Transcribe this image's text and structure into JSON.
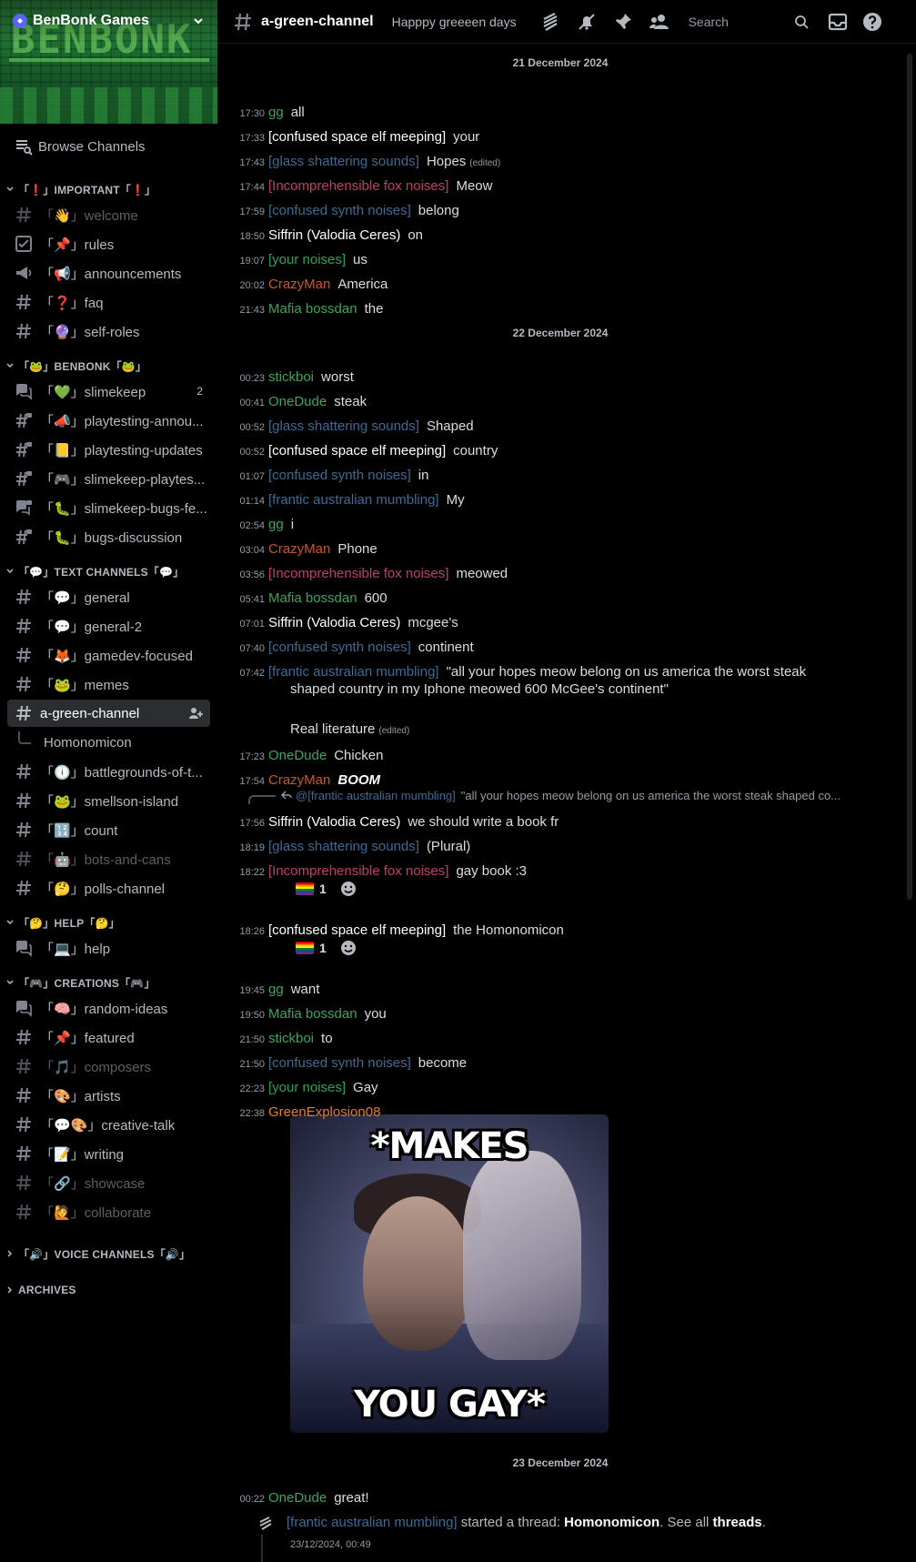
{
  "server": {
    "name": "BenBonk Games",
    "banner_text": "BENBONK"
  },
  "sidebar": {
    "browse_label": "Browse Channels",
    "categories": [
      {
        "label": "「❗」IMPORTANT「❗」",
        "channels": [
          {
            "label": "「👋」welcome",
            "icon": "hash",
            "muted": true
          },
          {
            "label": "「📌」rules",
            "icon": "rules"
          },
          {
            "label": "「📢」announcements",
            "icon": "announce"
          },
          {
            "label": "「❓」faq",
            "icon": "hash"
          },
          {
            "label": "「🔮」self-roles",
            "icon": "hash"
          }
        ]
      },
      {
        "label": "「🐸」BENBONK「🐸」",
        "channels": [
          {
            "label": "「💚」slimekeep",
            "icon": "forum",
            "badge": "2"
          },
          {
            "label": "「📣」playtesting-annou...",
            "icon": "hash-lock"
          },
          {
            "label": "「📒」playtesting-updates",
            "icon": "hash-lock"
          },
          {
            "label": "「🎮」slimekeep-playtes...",
            "icon": "hash-lock"
          },
          {
            "label": "「🐛」slimekeep-bugs-fe...",
            "icon": "forum-lock"
          },
          {
            "label": "「🐛」bugs-discussion",
            "icon": "hash-lock"
          }
        ]
      },
      {
        "label": "「💬」TEXT CHANNELS「💬」",
        "channels": [
          {
            "label": "「💬」general",
            "icon": "hash"
          },
          {
            "label": "「💬」general-2",
            "icon": "hash"
          },
          {
            "label": "「🦊」gamedev-focused",
            "icon": "hash"
          },
          {
            "label": "「🐸」memes",
            "icon": "hash"
          },
          {
            "label": "a-green-channel",
            "icon": "hash",
            "active": true
          },
          {
            "label": "Homonomicon",
            "icon": "thread"
          },
          {
            "label": "「🕕」battlegrounds-of-t...",
            "icon": "hash"
          },
          {
            "label": "「🐸」smellson-island",
            "icon": "hash"
          },
          {
            "label": "「🔢」count",
            "icon": "hash"
          },
          {
            "label": "「🤖」bots-and-cans",
            "icon": "hash",
            "muted": true
          },
          {
            "label": "「🤔」polls-channel",
            "icon": "hash"
          }
        ]
      },
      {
        "label": "「🤔」HELP「🤔」",
        "channels": [
          {
            "label": "「💻」help",
            "icon": "forum"
          }
        ]
      },
      {
        "label": "「🎮」CREATIONS「🎮」",
        "channels": [
          {
            "label": "「🧠」random-ideas",
            "icon": "forum"
          },
          {
            "label": "「📌」featured",
            "icon": "hash"
          },
          {
            "label": "「🎵」composers",
            "icon": "hash",
            "muted": true
          },
          {
            "label": "「🎨」artists",
            "icon": "hash"
          },
          {
            "label": "「💬🎨」creative-talk",
            "icon": "hash"
          },
          {
            "label": "「📝」writing",
            "icon": "hash"
          },
          {
            "label": "「🔗」showcase",
            "icon": "hash",
            "muted": true
          },
          {
            "label": "「🙋」collaborate",
            "icon": "hash",
            "muted": true
          }
        ]
      }
    ],
    "collapsed_categories": [
      "「🔊」VOICE CHANNELS「🔊」",
      "ARCHIVES"
    ]
  },
  "header": {
    "channel": "a-green-channel",
    "topic": "Happpy greeeen days",
    "search_placeholder": "Search"
  },
  "colors": {
    "green": "#23a559",
    "blue": "#3c6b94",
    "pink": "#c43c6b",
    "orange": "#c9562a",
    "white": "#ffffff",
    "lime": "#3ba55d",
    "orange2": "#e67e22"
  },
  "messages": {
    "date1": "21 December 2024",
    "date2": "22 December 2024",
    "date3": "23 December 2024",
    "list": [
      {
        "time": "17:30",
        "author": "gg",
        "color": "#3ba55d",
        "content": "all"
      },
      {
        "time": "17:33",
        "author": "[confused space elf meeping]",
        "color": "#ffffff",
        "content": "your"
      },
      {
        "time": "17:43",
        "author": "[glass shattering sounds]",
        "color": "#3c6b94",
        "content": "Hopes",
        "edited": "(edited)"
      },
      {
        "time": "17:44",
        "author": "[Incomprehensible fox noises]",
        "color": "#c43c6b",
        "content": "Meow"
      },
      {
        "time": "17:59",
        "author": "[confused synth noises]",
        "color": "#3c6b94",
        "content": "belong"
      },
      {
        "time": "18:50",
        "author": "Siffrin (Valodia Ceres)",
        "color": "#ffffff",
        "content": "on"
      },
      {
        "time": "19:07",
        "author": "[your noises]",
        "color": "#23a559",
        "content": "us"
      },
      {
        "time": "20:02",
        "author": "CrazyMan",
        "color": "#c9562a",
        "content": "America"
      },
      {
        "time": "21:43",
        "author": "Mafia bossdan",
        "color": "#3ba55d",
        "content": "the"
      },
      {
        "time": "00:23",
        "author": "stickboi",
        "color": "#3ba55d",
        "content": "worst"
      },
      {
        "time": "00:41",
        "author": "OneDude",
        "color": "#3ba55d",
        "content": "steak"
      },
      {
        "time": "00:52",
        "author": "[glass shattering sounds]",
        "color": "#3c6b94",
        "content": "Shaped"
      },
      {
        "time": "00:52",
        "author": "[confused space elf meeping]",
        "color": "#ffffff",
        "content": "country"
      },
      {
        "time": "01:07",
        "author": "[confused synth noises]",
        "color": "#3c6b94",
        "content": "in"
      },
      {
        "time": "01:14",
        "author": "[frantic australian mumbling]",
        "color": "#3c6b94",
        "content": "My"
      },
      {
        "time": "02:54",
        "author": "gg",
        "color": "#3ba55d",
        "content": "i"
      },
      {
        "time": "03:04",
        "author": "CrazyMan",
        "color": "#c9562a",
        "content": "Phone"
      },
      {
        "time": "03:56",
        "author": "[Incomprehensible fox noises]",
        "color": "#c43c6b",
        "content": "meowed"
      },
      {
        "time": "05:41",
        "author": "Mafia bossdan",
        "color": "#3ba55d",
        "content": "600"
      },
      {
        "time": "07:01",
        "author": "Siffrin (Valodia Ceres)",
        "color": "#ffffff",
        "content": "mcgee's"
      },
      {
        "time": "07:40",
        "author": "[confused synth noises]",
        "color": "#3c6b94",
        "content": "continent"
      },
      {
        "time": "07:42",
        "author": "[frantic australian mumbling]",
        "color": "#3c6b94",
        "content": "\"all your hopes meow belong on us america the worst steak"
      },
      {
        "time": "17:23",
        "author": "OneDude",
        "color": "#3ba55d",
        "content": "Chicken"
      },
      {
        "time": "17:54",
        "author": "CrazyMan",
        "color": "#c9562a",
        "content": "BOOM"
      },
      {
        "time": "17:56",
        "author": "Siffrin (Valodia Ceres)",
        "color": "#ffffff",
        "content": "we should write a book fr"
      },
      {
        "time": "18:19",
        "author": "[glass shattering sounds]",
        "color": "#3c6b94",
        "content": "(Plural)"
      },
      {
        "time": "18:22",
        "author": "[Incomprehensible fox noises]",
        "color": "#c43c6b",
        "content": "gay book :3"
      },
      {
        "time": "18:26",
        "author": "[confused space elf meeping]",
        "color": "#ffffff",
        "content": "the Homonomicon"
      },
      {
        "time": "19:45",
        "author": "gg",
        "color": "#3ba55d",
        "content": "want"
      },
      {
        "time": "19:50",
        "author": "Mafia bossdan",
        "color": "#3ba55d",
        "content": "you"
      },
      {
        "time": "21:50",
        "author": "stickboi",
        "color": "#3ba55d",
        "content": "to"
      },
      {
        "time": "21:50",
        "author": "[confused synth noises]",
        "color": "#3c6b94",
        "content": "become"
      },
      {
        "time": "22:23",
        "author": "[your noises]",
        "color": "#23a559",
        "content": "Gay"
      },
      {
        "time": "22:38",
        "author": "GreenExplosion08",
        "color": "#e67e22",
        "content": ""
      },
      {
        "time": "00:22",
        "author": "OneDude",
        "color": "#3ba55d",
        "content": "great!"
      }
    ],
    "wrap_line2": "shaped country in my Iphone meowed 600 McGee's continent\"",
    "wrap_line3": "Real literature",
    "wrap_edited": "(edited)",
    "reply_author": "@[frantic australian mumbling]",
    "reply_text": "\"all your hopes meow belong on us america the worst steak shaped co...",
    "reaction_count_1": "1",
    "reaction_count_2": "1",
    "meme_top": "*MAKES",
    "meme_bottom": "YOU GAY*",
    "thread_author": "[frantic australian mumbling]",
    "thread_started": " started a thread: ",
    "thread_name": "Homonomicon",
    "thread_see": ". See all ",
    "thread_link": "threads",
    "thread_end": ".",
    "thread_date": "23/12/2024, 00:49"
  }
}
